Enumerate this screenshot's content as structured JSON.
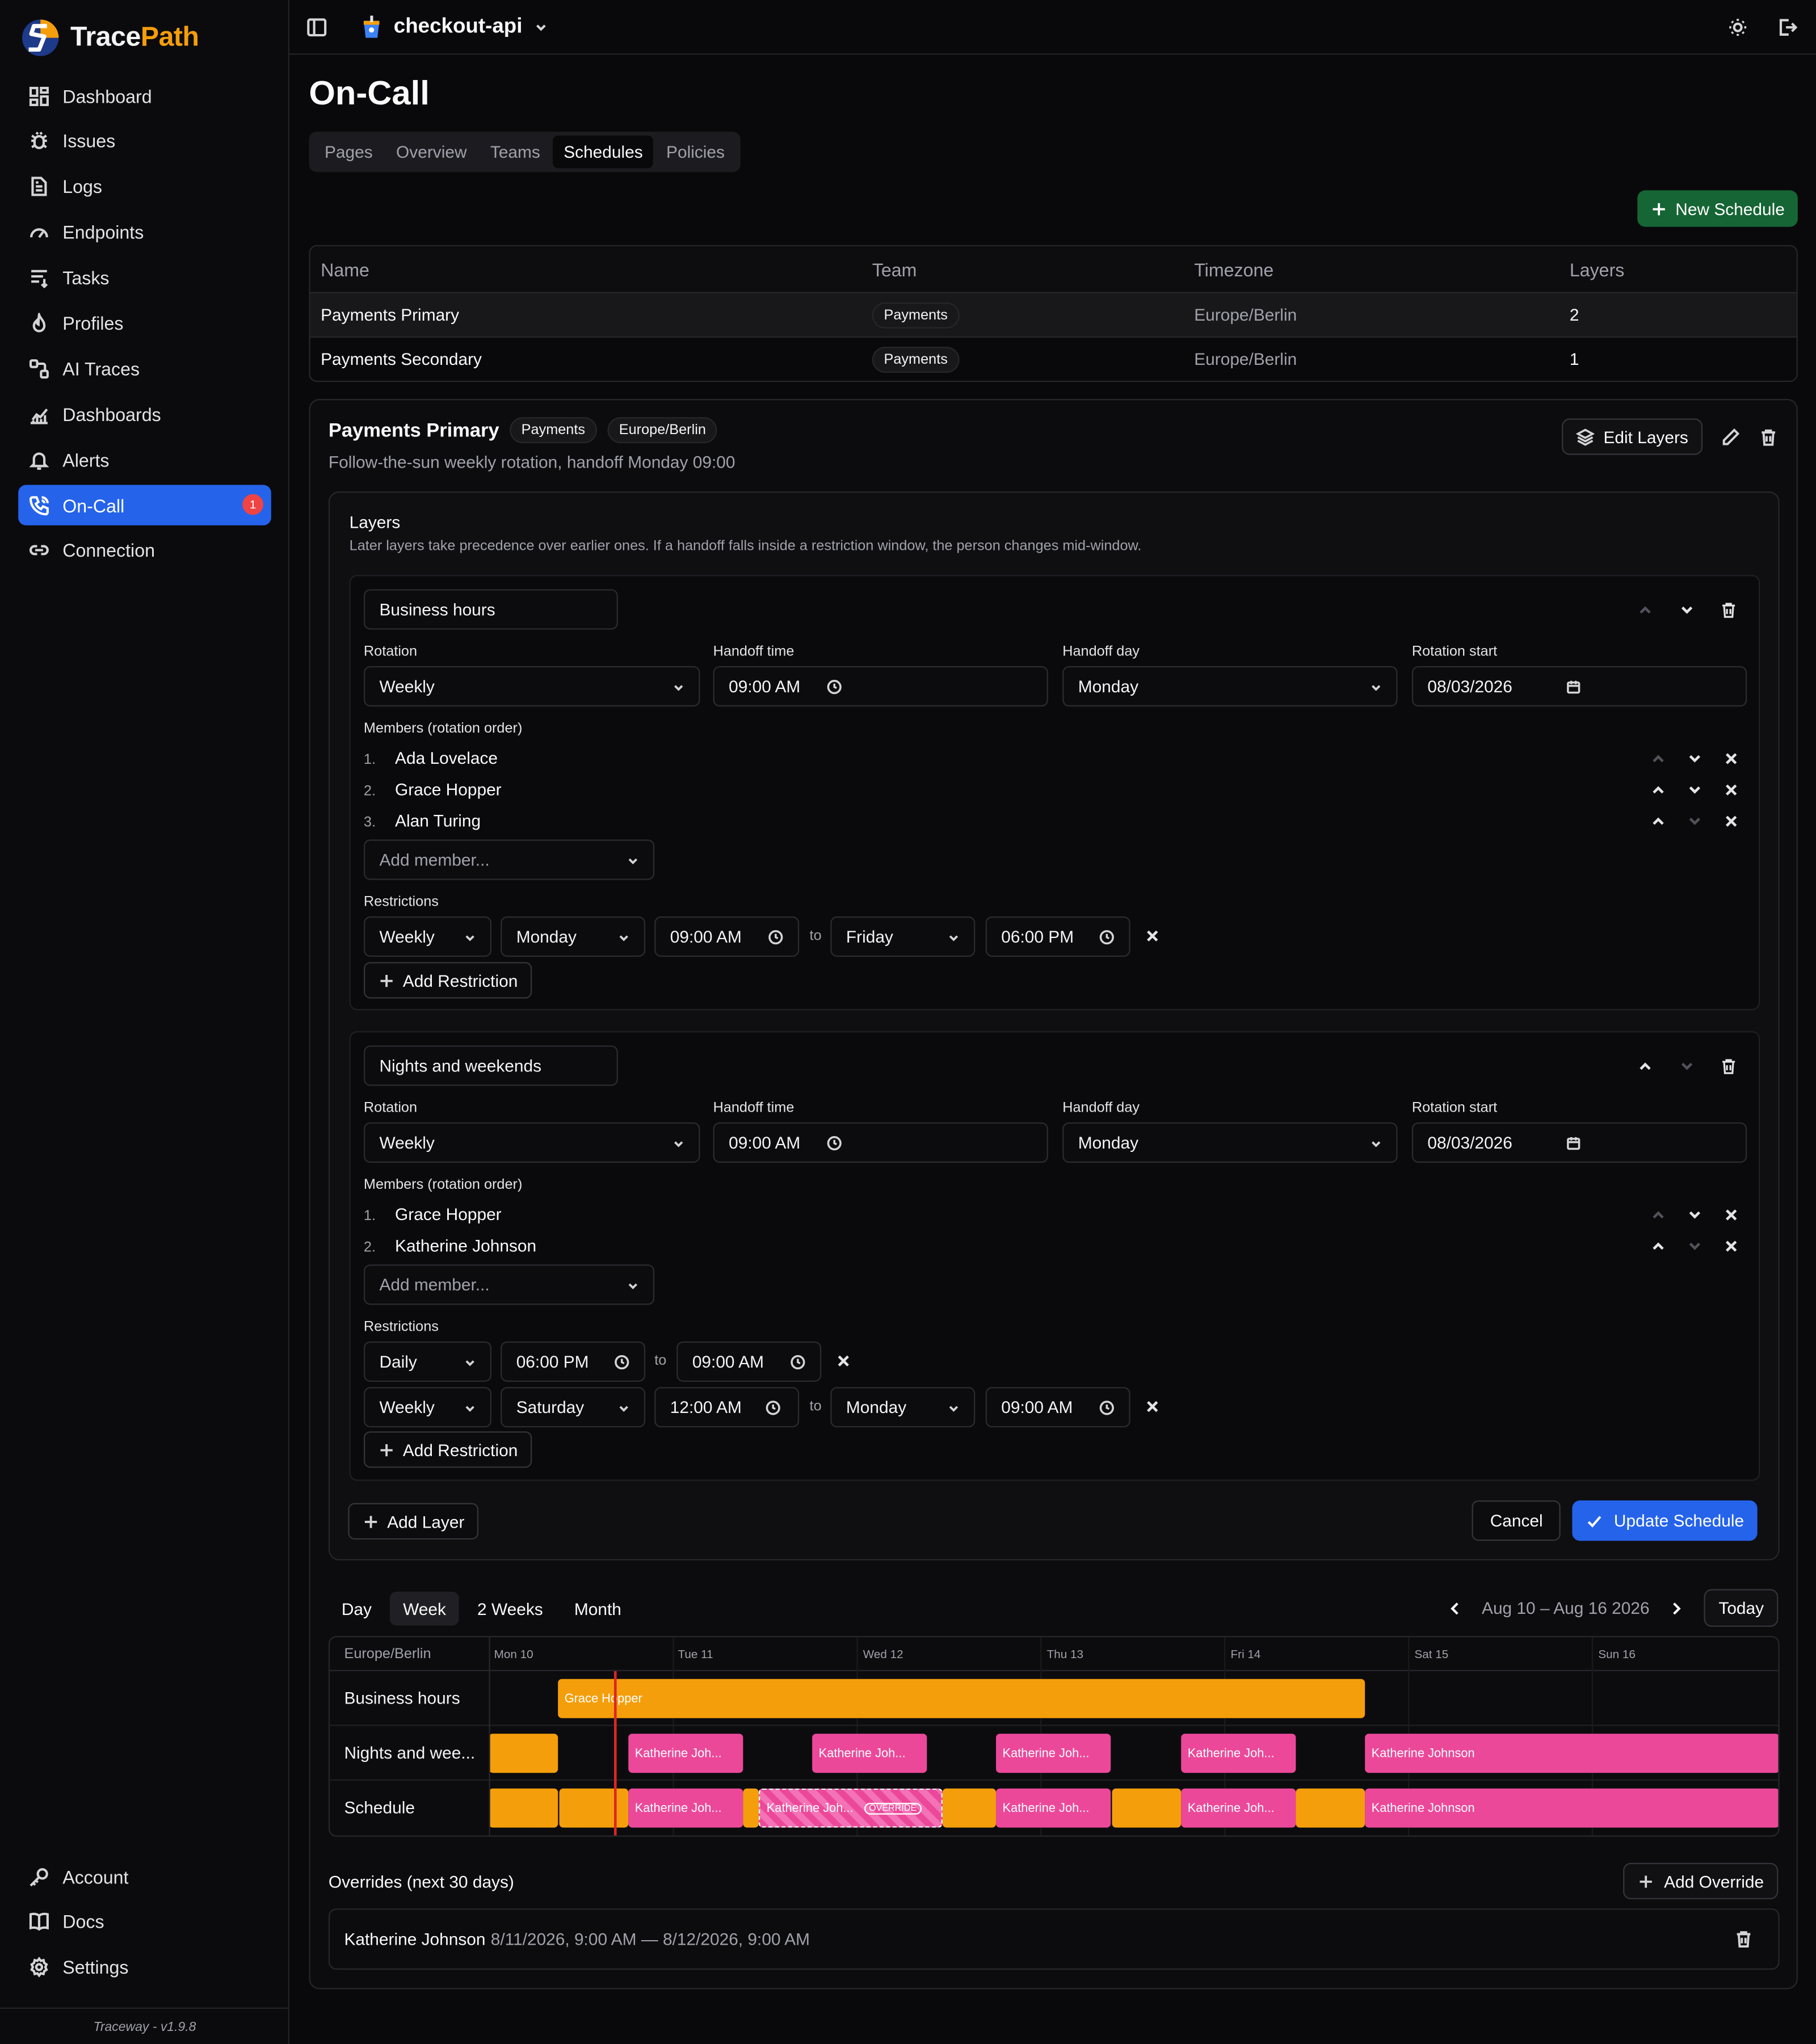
{
  "brand": {
    "name_a": "Trace",
    "name_b": "Path",
    "version": "Traceway - v1.9.8"
  },
  "nav": [
    {
      "label": "Dashboard",
      "icon": "dashboard-icon"
    },
    {
      "label": "Issues",
      "icon": "bug-icon"
    },
    {
      "label": "Logs",
      "icon": "file-icon"
    },
    {
      "label": "Endpoints",
      "icon": "gauge-icon"
    },
    {
      "label": "Tasks",
      "icon": "tasks-icon"
    },
    {
      "label": "Profiles",
      "icon": "flame-icon"
    },
    {
      "label": "AI Traces",
      "icon": "ai-traces-icon"
    },
    {
      "label": "Dashboards",
      "icon": "chart-icon"
    },
    {
      "label": "Alerts",
      "icon": "bell-icon"
    },
    {
      "label": "On-Call",
      "icon": "phone-icon",
      "badge": "1",
      "active": true
    },
    {
      "label": "Connection",
      "icon": "link-icon"
    }
  ],
  "nav_bottom": [
    {
      "label": "Account",
      "icon": "key-icon"
    },
    {
      "label": "Docs",
      "icon": "book-icon"
    },
    {
      "label": "Settings",
      "icon": "gear-icon"
    }
  ],
  "topbar": {
    "project": "checkout-api"
  },
  "page": {
    "title": "On-Call",
    "tabs": [
      "Pages",
      "Overview",
      "Teams",
      "Schedules",
      "Policies"
    ],
    "active_tab": "Schedules",
    "new_schedule": "New Schedule"
  },
  "table": {
    "headers": [
      "Name",
      "Team",
      "Timezone",
      "Layers"
    ],
    "rows": [
      {
        "name": "Payments Primary",
        "team": "Payments",
        "tz": "Europe/Berlin",
        "layers": "2"
      },
      {
        "name": "Payments Secondary",
        "team": "Payments",
        "tz": "Europe/Berlin",
        "layers": "1"
      }
    ]
  },
  "detail": {
    "title": "Payments Primary",
    "team": "Payments",
    "tz": "Europe/Berlin",
    "subtitle": "Follow-the-sun weekly rotation, handoff Monday 09:00",
    "edit_layers": "Edit Layers"
  },
  "layers_panel": {
    "title": "Layers",
    "desc": "Later layers take precedence over earlier ones. If a handoff falls inside a restriction window, the person changes mid-window.",
    "labels": {
      "rotation": "Rotation",
      "handoff_time": "Handoff time",
      "handoff_day": "Handoff day",
      "rotation_start": "Rotation start",
      "members": "Members (rotation order)",
      "restrictions": "Restrictions",
      "add_member": "Add member...",
      "add_restriction": "Add Restriction",
      "to": "to"
    },
    "layer1": {
      "name": "Business hours",
      "rotation": "Weekly",
      "handoff_time": "09:00  AM",
      "handoff_day": "Monday",
      "rotation_start": "08/03/2026",
      "members": [
        {
          "n": "1.",
          "name": "Ada Lovelace"
        },
        {
          "n": "2.",
          "name": "Grace Hopper"
        },
        {
          "n": "3.",
          "name": "Alan Turing"
        }
      ],
      "restriction": {
        "freq": "Weekly",
        "from_day": "Monday",
        "from_time": "09:00  AM",
        "to_day": "Friday",
        "to_time": "06:00  PM"
      }
    },
    "layer2": {
      "name": "Nights and weekends",
      "rotation": "Weekly",
      "handoff_time": "09:00  AM",
      "handoff_day": "Monday",
      "rotation_start": "08/03/2026",
      "members": [
        {
          "n": "1.",
          "name": "Grace Hopper"
        },
        {
          "n": "2.",
          "name": "Katherine Johnson"
        }
      ],
      "restriction1": {
        "freq": "Daily",
        "from_time": "06:00  PM",
        "to_time": "09:00  AM"
      },
      "restriction2": {
        "freq": "Weekly",
        "from_day": "Saturday",
        "from_time": "12:00  AM",
        "to_day": "Monday",
        "to_time": "09:00  AM"
      }
    },
    "add_layer": "Add Layer",
    "cancel": "Cancel",
    "update": "Update Schedule"
  },
  "calendar": {
    "views": [
      "Day",
      "Week",
      "2 Weeks",
      "Month"
    ],
    "active_view": "Week",
    "range": "Aug 10 – Aug 16 2026",
    "today": "Today",
    "tz": "Europe/Berlin",
    "days": [
      "Mon 10",
      "Tue 11",
      "Wed 12",
      "Thu 13",
      "Fri 14",
      "Sat 15",
      "Sun 16"
    ],
    "rows": [
      "Business hours",
      "Nights and wee...",
      "Schedule"
    ],
    "bar_labels": {
      "grace": "Grace Hopper",
      "kj_short": "Katherine Joh...",
      "kj_full": "Katherine Johnson",
      "override": "OVERRIDE"
    },
    "colors": {
      "layer1": "#f59e0b",
      "layer2": "#ec4899",
      "now": "#dc2626"
    }
  },
  "overrides": {
    "title": "Overrides (next 30 days)",
    "add": "Add Override",
    "items": [
      {
        "who": "Katherine Johnson",
        "when": "8/11/2026, 9:00 AM — 8/12/2026, 9:00 AM"
      }
    ]
  }
}
